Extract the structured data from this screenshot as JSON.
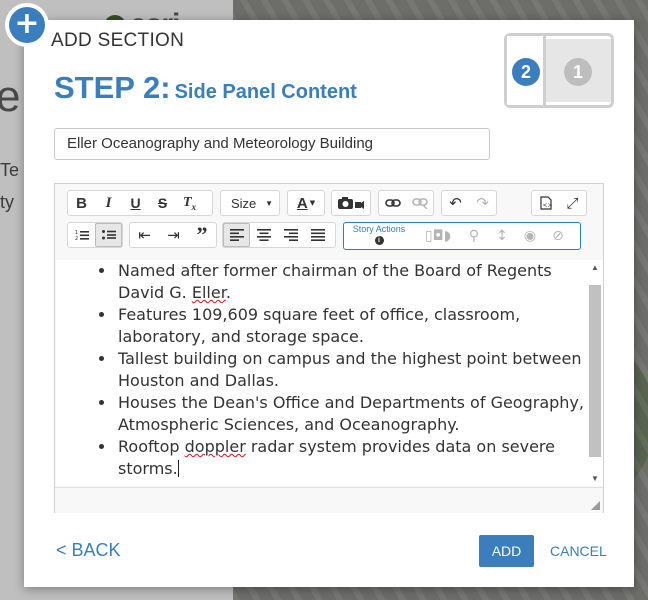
{
  "background": {
    "logo_text": "esri",
    "big_letter": "e",
    "snippet_1": "Te",
    "snippet_2": "ty"
  },
  "dialog": {
    "title": "ADD SECTION",
    "step_label": "STEP 2:",
    "step_subtitle": "Side Panel Content",
    "layout_preview": {
      "side_number": "2",
      "main_number": "1"
    },
    "title_field_value": "Eller Oceanography and Meteorology Building"
  },
  "toolbar": {
    "bold": "B",
    "italic": "I",
    "underline": "U",
    "strikethrough": "S",
    "clear_format": "Tx",
    "size_label": "Size",
    "font_color": "A",
    "story_actions_label": "Story Actions"
  },
  "content": {
    "bullets": [
      {
        "pre": "Named after former chairman of the Board of Regents David G. ",
        "misspelled": "Eller",
        "post": "."
      },
      {
        "pre": "Features 109,609 square feet of office, classroom, laboratory, and storage space.",
        "misspelled": "",
        "post": ""
      },
      {
        "pre": "Tallest building on campus and the highest point between Houston and Dallas.",
        "misspelled": "",
        "post": ""
      },
      {
        "pre": "Houses the Dean's Office and Departments of Geography, Atmospheric Sciences, and Oceanography.",
        "misspelled": "",
        "post": ""
      },
      {
        "pre": "Rooftop ",
        "misspelled": "doppler",
        "post": " radar system provides data on severe storms."
      }
    ]
  },
  "footer": {
    "back_label": "< BACK",
    "add_label": "ADD",
    "cancel_label": "CANCEL"
  },
  "colors": {
    "accent": "#3a7ebd",
    "story_border": "#2e7fb5"
  }
}
